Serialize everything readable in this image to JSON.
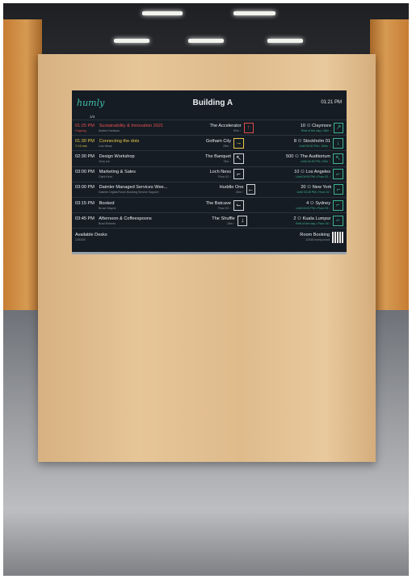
{
  "display": {
    "brand": "humly",
    "title": "Building A",
    "clock": "01:21 PM",
    "page_indicator": "1/4"
  },
  "bookings": [
    {
      "time": "01:25 PM",
      "title": "Sustainability & Innovation 2021",
      "sub_status": "Ongoing",
      "sub_person": "Anders Karlsson",
      "room": "The Accelerator",
      "room_info": "50m ↑",
      "icon": "arrow-up-icon",
      "state": "red",
      "next_name": "Claymore",
      "next_info": "Rest of the day • 45m ↑",
      "next_cap": "10",
      "next_icon": "arrow-up-right-icon"
    },
    {
      "time": "01:30 PM",
      "title": "Connecting the dots",
      "sub_status": "⏱ 10 min",
      "sub_person": "Luis Weas",
      "room": "Gotham City",
      "room_info": "25m ↑",
      "icon": "arrow-right-icon",
      "state": "yel",
      "next_name": "Stockholm 01",
      "next_info": "Until 03:30 PM • 100m ↑",
      "next_cap": "8",
      "next_icon": "arrow-down-icon"
    },
    {
      "time": "02:30 PM",
      "title": "Design Workshop",
      "sub_status": "",
      "sub_person": "Jerry Ice",
      "room": "The Banquet",
      "room_info": "75m ↑",
      "icon": "arrow-up-left-icon",
      "state": "",
      "next_name": "The Auditorium",
      "next_info": "Until 04:30 PM • 20m ↑",
      "next_cap": "500",
      "next_icon": "arrow-up-left-icon"
    },
    {
      "time": "03:00 PM",
      "title": "Marketing & Sales",
      "sub_status": "",
      "sub_person": "Clark Kent",
      "room": "Loch Ness",
      "room_info": "Floor 02 ↑",
      "icon": "stairs-icon",
      "state": "",
      "next_name": "Los Angeles",
      "next_info": "Until 04:00 PM • Floor 02 ↑",
      "next_cap": "10",
      "next_icon": "stairs-icon"
    },
    {
      "time": "03:00 PM",
      "title": "Daimler Managed Services Wee...",
      "sub_status": "",
      "sub_person": "Daimler Digital Room Booking Service Support",
      "room": "Huddle One",
      "room_info": "45m ↑",
      "icon": "arrow-left-icon",
      "state": "",
      "next_name": "New York",
      "next_info": "Until 03:45 PM • Floor 02 ↑",
      "next_cap": "20",
      "next_icon": "stairs-icon"
    },
    {
      "time": "03:15 PM",
      "title": "Booked",
      "sub_status": "",
      "sub_person": "Bruce Wayne",
      "room": "The Batcave",
      "room_info": "Floor 00 ↑",
      "icon": "stairs-down-icon",
      "state": "",
      "next_name": "Sydney",
      "next_info": "Until 03:00 PM • Floor 03 ↑",
      "next_cap": "4",
      "next_icon": "stairs-icon"
    },
    {
      "time": "03:45 PM",
      "title": "Afternoon & Coffeespoons",
      "sub_status": "",
      "sub_person": "Brad Roberts",
      "room": "The Shuffle",
      "room_info": "15m ↑",
      "icon": "arrow-down-icon",
      "state": "",
      "next_name": "Kuala Lumpur",
      "next_info": "Rest of the day • Floor 04 ↑",
      "next_cap": "2",
      "next_icon": "stairs-icon"
    }
  ],
  "footer": {
    "left_label": "Available Desks",
    "left_value": "125/200",
    "right_label": "Room Booking",
    "right_value": "12345.humly.cloud"
  },
  "colors": {
    "accent": "#43c1ab",
    "ongoing": "#e5514e",
    "upcoming": "#e8c949",
    "available": "#3fb38b"
  }
}
